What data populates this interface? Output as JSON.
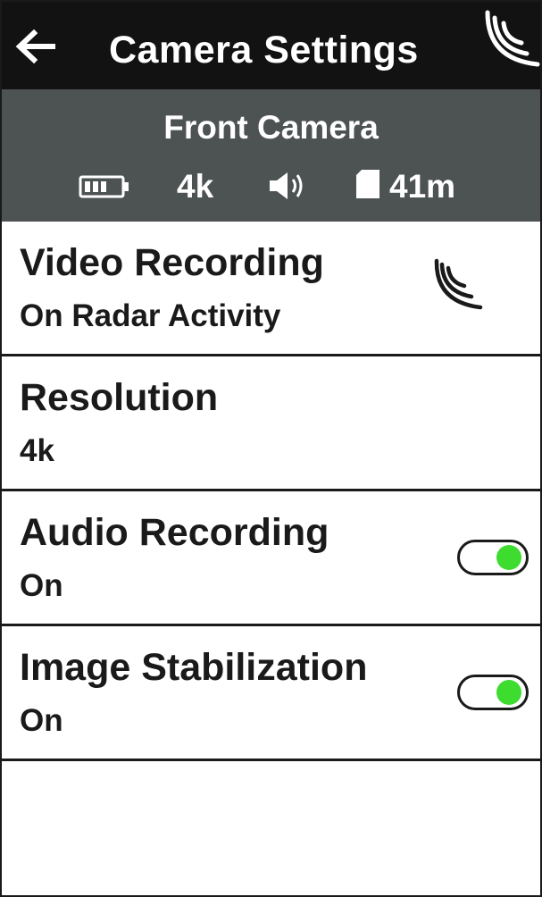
{
  "header": {
    "back_icon": "arrow-left-icon",
    "title": "Camera Settings",
    "status_icon": "radar-icon"
  },
  "camera_status": {
    "name": "Front Camera",
    "battery_icon": "battery-icon",
    "resolution": "4k",
    "audio_icon": "speaker-icon",
    "storage_icon": "sd-card-icon",
    "recording_time": "41m"
  },
  "settings": [
    {
      "label": "Video Recording",
      "value": "On Radar Activity",
      "icon": "radar-icon"
    },
    {
      "label": "Resolution",
      "value": "4k"
    },
    {
      "label": "Audio Recording",
      "value": "On",
      "toggle_on": true
    },
    {
      "label": "Image Stabilization",
      "value": "On",
      "toggle_on": true
    }
  ],
  "colors": {
    "header_bg": "#121212",
    "status_bg": "#4d5253",
    "toggle_on": "#3ddc2e"
  }
}
